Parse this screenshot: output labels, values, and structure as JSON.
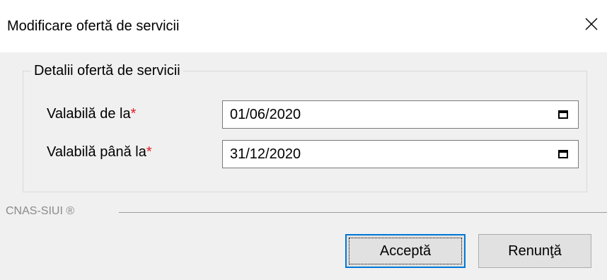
{
  "dialog": {
    "title": "Modificare ofertă de servicii",
    "close_icon": "close-icon"
  },
  "group": {
    "legend": "Detalii ofertă de servicii",
    "fields": [
      {
        "label": "Valabilă de la",
        "required_mark": "*",
        "value": "01/06/2020",
        "icon": "calendar-icon"
      },
      {
        "label": "Valabilă până la",
        "required_mark": "*",
        "value": "31/12/2020",
        "icon": "calendar-icon"
      }
    ]
  },
  "footer": {
    "brand": "CNAS-SIUI ®"
  },
  "buttons": {
    "accept": "Acceptă",
    "cancel": "Renunţă"
  },
  "colors": {
    "required": "#e01b24",
    "focus_border": "#0078d7",
    "dialog_bg": "#f0f0f0"
  }
}
